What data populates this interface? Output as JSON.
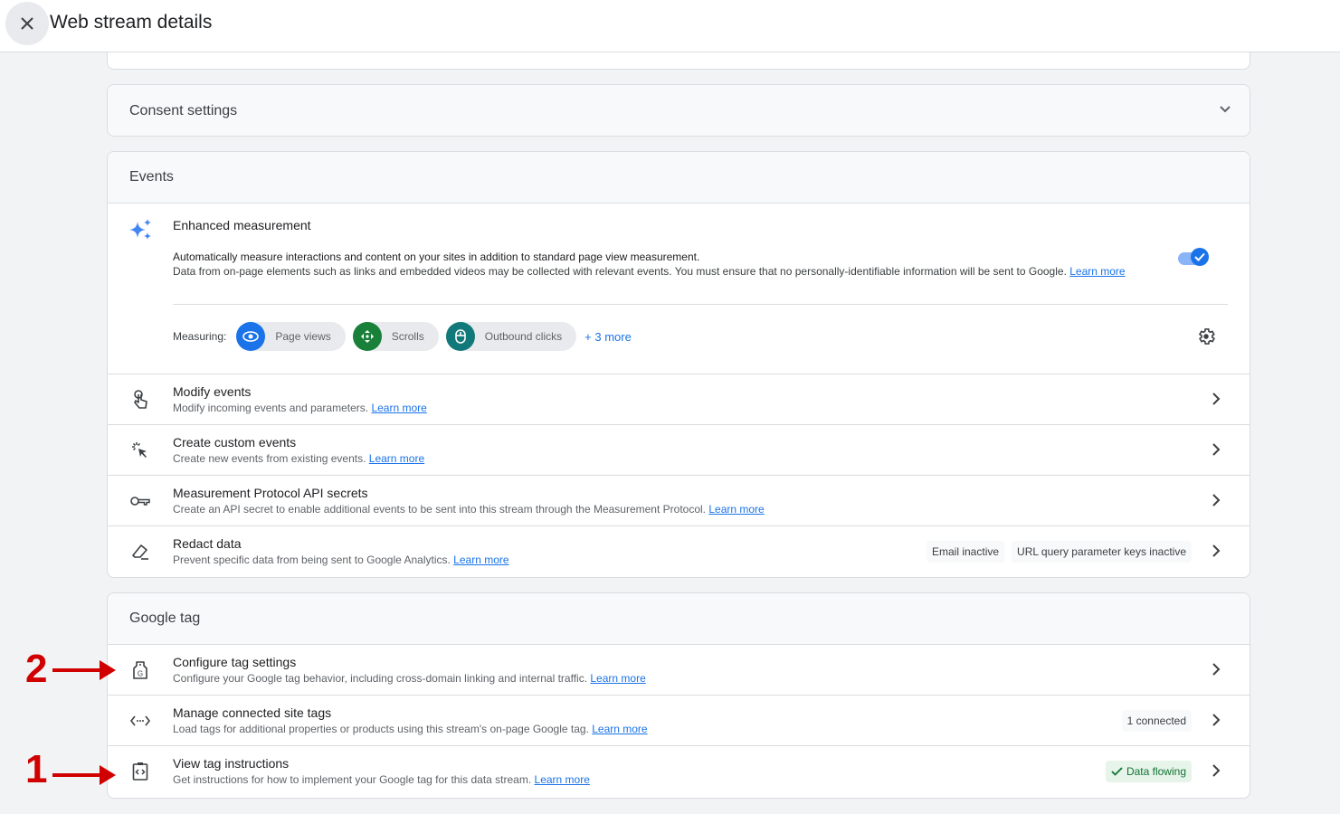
{
  "header": {
    "title": "Web stream details",
    "close_icon": "close-icon"
  },
  "consent": {
    "title": "Consent settings"
  },
  "events": {
    "title": "Events",
    "enhanced_measurement": {
      "title": "Enhanced measurement",
      "desc_line1": "Automatically measure interactions and content on your sites in addition to standard page view measurement.",
      "desc_line2": "Data from on-page elements such as links and embedded videos may be collected with relevant events. You must ensure that no personally-identifiable information will be sent to Google. ",
      "learn_more": "Learn more",
      "toggle_on": true,
      "measuring_label": "Measuring:",
      "chips": [
        {
          "label": "Page views",
          "icon": "eye-icon",
          "color": "#1a73e8"
        },
        {
          "label": "Scrolls",
          "icon": "scroll-arrows-icon",
          "color": "#188038"
        },
        {
          "label": "Outbound clicks",
          "icon": "mouse-icon",
          "color": "#12797a"
        }
      ],
      "more_label": "+ 3 more"
    },
    "rows": [
      {
        "title": "Modify events",
        "desc": "Modify incoming events and parameters. ",
        "link": "Learn more",
        "icon": "touch-hand-icon"
      },
      {
        "title": "Create custom events",
        "desc": "Create new events from existing events. ",
        "link": "Learn more",
        "icon": "cursor-click-icon"
      },
      {
        "title": "Measurement Protocol API secrets",
        "desc": "Create an API secret to enable additional events to be sent into this stream through the Measurement Protocol. ",
        "link": "Learn more",
        "icon": "key-icon"
      },
      {
        "title": "Redact data",
        "desc": "Prevent specific data from being sent to Google Analytics. ",
        "link": "Learn more",
        "icon": "eraser-icon",
        "badges": [
          "Email inactive",
          "URL query parameter keys inactive"
        ]
      }
    ]
  },
  "google_tag": {
    "title": "Google tag",
    "rows": [
      {
        "title": "Configure tag settings",
        "desc": "Configure your Google tag behavior, including cross-domain linking and internal traffic. ",
        "link": "Learn more",
        "icon": "google-tag-icon"
      },
      {
        "title": "Manage connected site tags",
        "desc": "Load tags for additional properties or products using this stream's on-page Google tag. ",
        "link": "Learn more",
        "icon": "code-dots-icon",
        "badge": "1 connected"
      },
      {
        "title": "View tag instructions",
        "desc": "Get instructions for how to implement your Google tag for this data stream. ",
        "link": "Learn more",
        "icon": "clipboard-code-icon",
        "badge": "Data flowing",
        "badge_status": "success"
      }
    ]
  },
  "annotations": [
    {
      "label": "2",
      "target": "Configure tag settings"
    },
    {
      "label": "1",
      "target": "View tag instructions"
    }
  ],
  "colors": {
    "accent": "#1a73e8",
    "annotation": "#d00000",
    "success": "#137333"
  }
}
